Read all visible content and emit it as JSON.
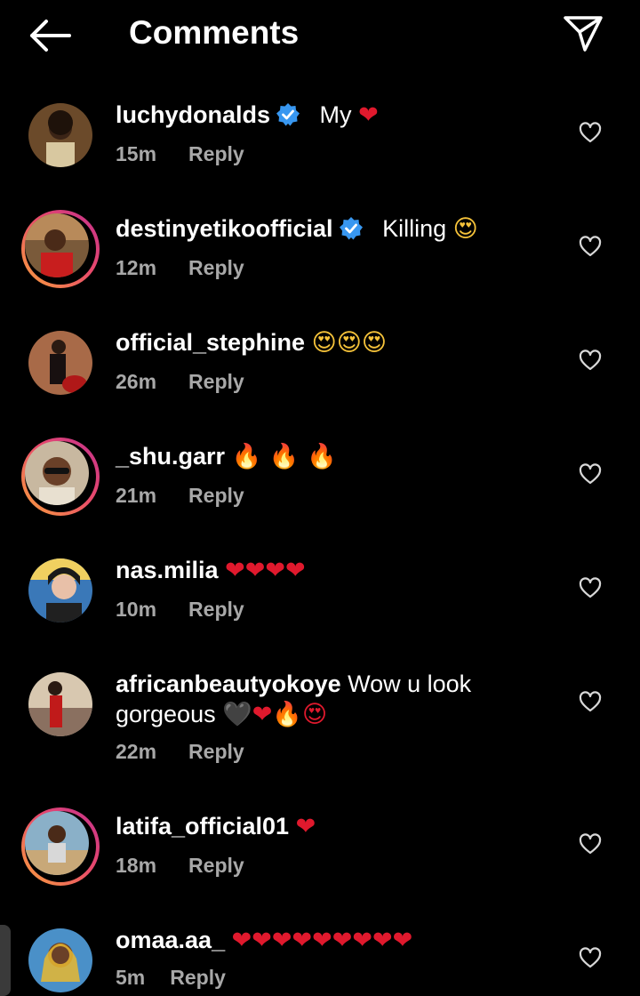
{
  "header": {
    "title": "Comments",
    "back_icon": "back-arrow-icon",
    "share_icon": "send-icon"
  },
  "reply_label": "Reply",
  "comments": [
    {
      "username": "luchydonalds",
      "verified": true,
      "text": "My",
      "emoji": "❤",
      "time": "15m",
      "story_ring": false
    },
    {
      "username": "destinyetikoofficial",
      "verified": true,
      "text": "Killing",
      "emoji": "😍",
      "time": "12m",
      "story_ring": true
    },
    {
      "username": "official_stephine",
      "verified": false,
      "text": "",
      "emoji": "😍😍😍",
      "time": "26m",
      "story_ring": false
    },
    {
      "username": "_shu.garr",
      "verified": false,
      "text": "",
      "emoji": "🔥 🔥 🔥",
      "time": "21m",
      "story_ring": true
    },
    {
      "username": "nas.milia",
      "verified": false,
      "text": "",
      "emoji": "❤❤❤❤",
      "time": "10m",
      "story_ring": false
    },
    {
      "username": "africanbeautyokoye",
      "verified": false,
      "text": "Wow u look gorgeous",
      "emoji": "🖤❤🔥😍",
      "time": "22m",
      "story_ring": false
    },
    {
      "username": "latifa_official01",
      "verified": false,
      "text": "",
      "emoji": "❤",
      "time": "18m",
      "story_ring": true
    },
    {
      "username": "omaa.aa_",
      "verified": false,
      "text": "",
      "emoji": "❤❤❤❤❤❤❤❤❤",
      "time": "5m",
      "story_ring": false
    }
  ],
  "colors": {
    "background": "#000000",
    "meta_text": "#a8a8a8",
    "verified_badge": "#3897f0",
    "story_ring_start": "#f9a23c",
    "story_ring_end": "#c2308f"
  }
}
